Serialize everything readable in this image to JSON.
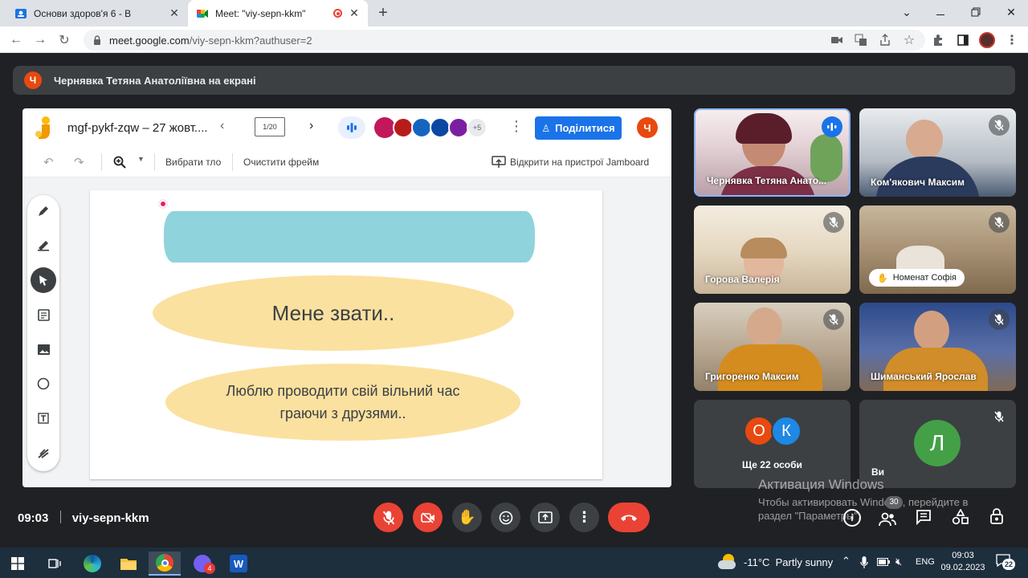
{
  "browser": {
    "tabs": [
      {
        "title": "Основи здоров'я 6 - В"
      },
      {
        "title": "Meet: \"viy-sepn-kkm\""
      }
    ],
    "url": {
      "host": "meet.google.com",
      "path": "/viy-sepn-kkm?authuser=2"
    }
  },
  "banner": {
    "initial": "Ч",
    "text": "Чернявка Тетяна Анатоліївна на екрані"
  },
  "jamboard": {
    "title": "mgf-pykf-zqw – 27 жовт....",
    "frame_counter": "1/20",
    "more_count": "+5",
    "share_label": "Поділитися",
    "user_initial": "Ч",
    "toolbar": {
      "set_background": "Вибрати тло",
      "clear_frame": "Очистити фрейм",
      "open_device": "Відкрити на пристрої Jamboard"
    },
    "slide": {
      "text1": "Мене звати..",
      "text2": "Люблю проводити свій вільний час граючи з друзями.."
    },
    "colors": {
      "top_oval": "#8fd3dc",
      "ovals": "#fbe1a0"
    }
  },
  "participants": [
    {
      "name": "Чернявка Тетяна Анато..."
    },
    {
      "name": "Ком'якович Максим"
    },
    {
      "name": "Горова Валерія"
    },
    {
      "name": "Номенат Софія"
    },
    {
      "name": "Григоренко Максим"
    },
    {
      "name": "Шиманський Ярослав"
    }
  ],
  "others": {
    "a": "О",
    "b": "К",
    "label": "Ще 22 особи"
  },
  "self": {
    "initial": "Л",
    "label": "Ви"
  },
  "meeting": {
    "time": "09:03",
    "code": "viy-sepn-kkm",
    "people_count": "30"
  },
  "watermark": {
    "title": "Активация Windows",
    "line1": "Чтобы активировать Windows, перейдите в",
    "line2": "раздел \"Параметры\"."
  },
  "taskbar": {
    "weather": "-11°C  Partly sunny",
    "lang": "ENG",
    "time": "09:03",
    "date": "09.02.2023",
    "notif": "22",
    "viber_badge": "4"
  }
}
